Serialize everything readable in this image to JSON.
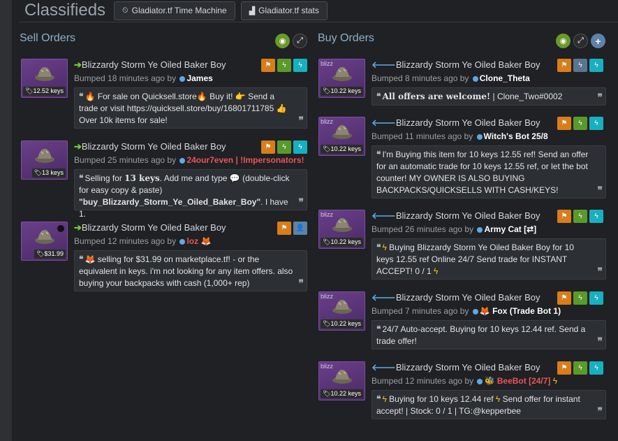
{
  "header": {
    "title": "Classifieds",
    "time_machine_label": "Gladiator.tf Time Machine",
    "stats_label": "Gladiator.tf stats"
  },
  "sell": {
    "title": "Sell Orders",
    "listings": [
      {
        "item": "Blizzardy Storm Ye Oiled Baker Boy",
        "price": "12.52 keys",
        "bumped": "Bumped 18 minutes ago by",
        "user": "James",
        "desc": [
          " For sale on Quicksell.store",
          " Buy it! ",
          " Send a trade or visit https://quicksell.store/buy/16801711785 ",
          " Over 10k items for sale!"
        ]
      },
      {
        "item": "Blizzardy Storm Ye Oiled Baker Boy",
        "price": "13 keys",
        "bumped": "Bumped 25 minutes ago by",
        "user": "24our7even | !Impersonators!",
        "desc_pre": "Selling for ",
        "desc_bold": "13 keys",
        "desc_mid": ". Add me and type ",
        "desc_post": " (double-click for easy copy & paste)",
        "desc_cmd": "\"buy_Blizzardy_Storm_Ye_Oiled_Baker_Boy\"",
        "desc_end": ". I have 1."
      },
      {
        "item": "Blizzardy Storm Ye Oiled Baker Boy",
        "price": "$31.99",
        "bumped": "Bumped 12 minutes ago by",
        "user": "loz",
        "desc": "selling for $31.99 on marketplace.tf! - or the equivalent in keys. i'm not looking for any item offers. also buying your backpacks with cash (1,000+ rep)"
      }
    ]
  },
  "buy": {
    "title": "Buy Orders",
    "listings": [
      {
        "item": "Blizzardy Storm Ye Oiled Baker Boy",
        "craft": "blizz",
        "price": "10.22 keys",
        "bumped": "Bumped 8 minutes ago by",
        "user": "Clone_Theta",
        "desc_bold": "All offers are welcome!",
        "desc": " | Clone_Two#0002"
      },
      {
        "item": "Blizzardy Storm Ye Oiled Baker Boy",
        "craft": "blizz",
        "price": "10.22 keys",
        "bumped": "Bumped 11 minutes ago by",
        "user": "Witch's Bot 25/8",
        "desc": "I'm Buying this item for 10 keys 12.55 ref! Send an offer for an automatic trade for 10 keys 12.55 ref, or let the bot counter! MY OWNER IS ALSO BUYING BACKPACKS/QUICKSELLS WITH CASH/KEYS!"
      },
      {
        "item": "Blizzardy Storm Ye Oiled Baker Boy",
        "craft": "blizz",
        "price": "10.22 keys",
        "bumped": "Bumped 26 minutes ago by",
        "user": "Army Cat [⇄]",
        "desc": " Buying Blizzardy Storm Ye Oiled Baker Boy for 10 keys 12.55 ref Online 24/7 Send trade for INSTANT ACCEPT! 0 / 1 "
      },
      {
        "item": "Blizzardy Storm Ye Oiled Baker Boy",
        "craft": "blizz",
        "price": "10.22 keys",
        "bumped": "Bumped 7 minutes ago by",
        "user": "Fox (Trade Bot 1)",
        "desc": "24/7 Auto-accept. Buying for 10 keys 12.44 ref. Send a trade offer!"
      },
      {
        "item": "Blizzardy Storm Ye Oiled Baker Boy",
        "craft": "blizz",
        "price": "10.22 keys",
        "bumped": "Bumped 12 minutes ago by",
        "user": "BeeBot [24/7]",
        "desc_a": " Buying for 10 keys 12.44 ref ",
        "desc_b": " Send offer for instant accept! | Stock: 0 / 1 | TG:@kepperbee"
      }
    ]
  },
  "colors": {
    "sell_arrow": "#6fcf3a",
    "buy_arrow": "#5ea9e6",
    "flag": "#d97d1a",
    "bolt_green": "#5a9a2a",
    "bolt_cyan": "#18b0c0",
    "impersonator": "#e8545a"
  },
  "icons": [
    "clock-icon",
    "bar-chart-icon",
    "eye-icon",
    "expand-icon",
    "plus-icon",
    "flag-icon",
    "bolt-icon",
    "tag-icon",
    "quote-icon",
    "user-icon"
  ]
}
